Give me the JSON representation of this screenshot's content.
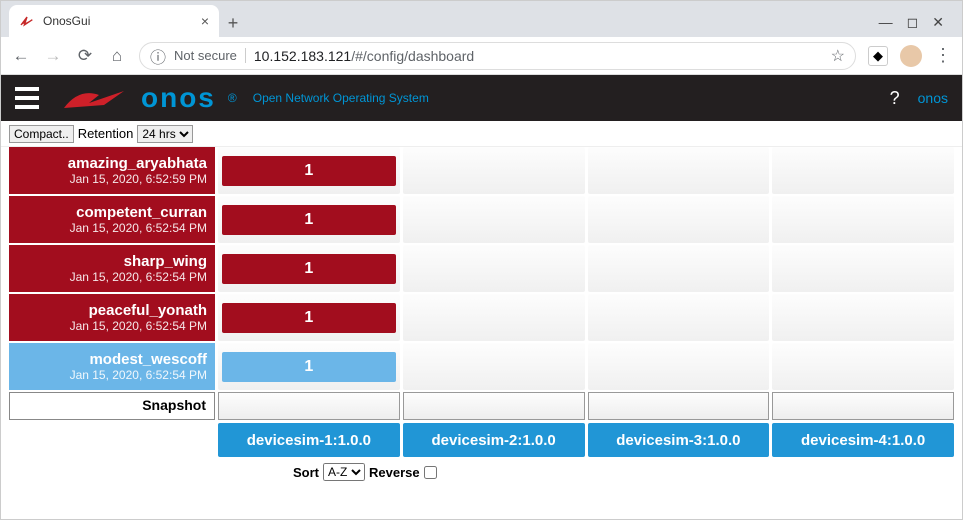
{
  "browser": {
    "tab_title": "OnosGui",
    "security_label": "Not secure",
    "url_host": "10.152.183.121",
    "url_path": "/#/config/dashboard"
  },
  "header": {
    "logo_text": "onos",
    "tagline": "Open Network Operating System",
    "help": "?",
    "user": "onos"
  },
  "toolbar": {
    "compact_label": "Compact..",
    "retention_label": "Retention",
    "retention_value": "24 hrs"
  },
  "rows": [
    {
      "name": "amazing_aryabhata",
      "time": "Jan 15, 2020, 6:52:59 PM",
      "color": "red",
      "blocks": [
        "1",
        "",
        "",
        ""
      ]
    },
    {
      "name": "competent_curran",
      "time": "Jan 15, 2020, 6:52:54 PM",
      "color": "red",
      "blocks": [
        "1",
        "",
        "",
        ""
      ]
    },
    {
      "name": "sharp_wing",
      "time": "Jan 15, 2020, 6:52:54 PM",
      "color": "red",
      "blocks": [
        "1",
        "",
        "",
        ""
      ]
    },
    {
      "name": "peaceful_yonath",
      "time": "Jan 15, 2020, 6:52:54 PM",
      "color": "red",
      "blocks": [
        "1",
        "",
        "",
        ""
      ]
    },
    {
      "name": "modest_wescoff",
      "time": "Jan 15, 2020, 6:52:54 PM",
      "color": "blue",
      "blocks": [
        "1",
        "",
        "",
        ""
      ]
    }
  ],
  "snapshot_label": "Snapshot",
  "devices": [
    "devicesim-1:1.0.0",
    "devicesim-2:1.0.0",
    "devicesim-3:1.0.0",
    "devicesim-4:1.0.0"
  ],
  "sort": {
    "label": "Sort",
    "value": "A-Z",
    "reverse_label": "Reverse"
  }
}
